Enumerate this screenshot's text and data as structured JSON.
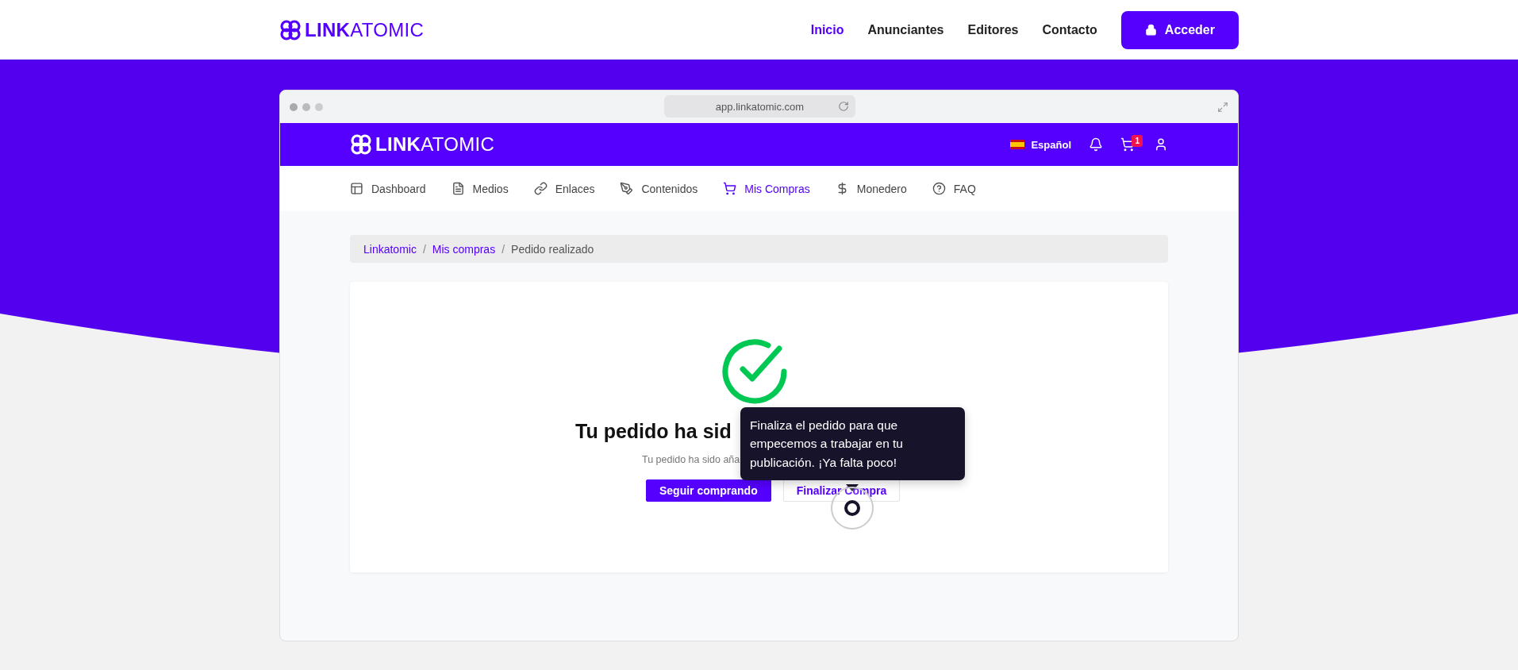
{
  "site_header": {
    "logo": "**LINK**ATOMIC",
    "nav": [
      {
        "label": "Inicio",
        "selected": true
      },
      {
        "label": "Anunciantes",
        "selected": false
      },
      {
        "label": "Editores",
        "selected": false
      },
      {
        "label": "Contacto",
        "selected": false
      }
    ],
    "login_button": "Acceder"
  },
  "browser": {
    "url": "app.linkatomic.com"
  },
  "app_header": {
    "logo": "**LINK**ATOMIC",
    "language": "Español",
    "cart_count": "1"
  },
  "app_nav": [
    {
      "label": "Dashboard",
      "selected": false
    },
    {
      "label": "Medios",
      "selected": false
    },
    {
      "label": "Enlaces",
      "selected": false
    },
    {
      "label": "Contenidos",
      "selected": false
    },
    {
      "label": "Mis Compras",
      "selected": true
    },
    {
      "label": "Monedero",
      "selected": false
    },
    {
      "label": "FAQ",
      "selected": false
    }
  ],
  "breadcrumb": [
    {
      "label": "Linkatomic",
      "kind": "link"
    },
    {
      "label": "/",
      "kind": "separator"
    },
    {
      "label": "Mis compras",
      "kind": "link"
    },
    {
      "label": "/",
      "kind": "separator"
    },
    {
      "label": "Pedido realizado",
      "kind": "current"
    }
  ],
  "confirmation": {
    "title": "Tu pedido ha sid",
    "subtitle": "Tu pedido ha sido aña",
    "buttons": [
      {
        "label": "Seguir comprando",
        "kind": "primary"
      },
      {
        "label": "Finalizar Compra",
        "kind": "secondary"
      }
    ]
  },
  "tooltip": {
    "text": "Finaliza el pedido para que empecemos a trabajar en tu publicación. ¡Ya falta poco!"
  }
}
